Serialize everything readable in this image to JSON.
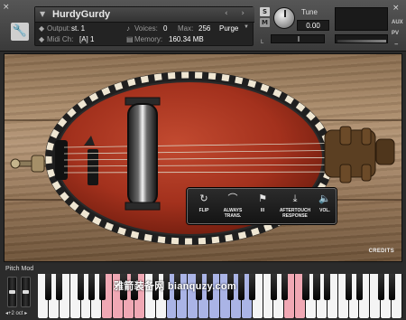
{
  "header": {
    "close_glyph": "×",
    "instrument": {
      "name": "HurdyGurdy",
      "nav": "‹ ›",
      "output_label": "Output:",
      "output_value": "st. 1",
      "voices_label": "Voices:",
      "voices_value": "0",
      "max_label": "Max:",
      "max_value": "256",
      "purge_label": "Purge",
      "midi_label": "Midi Ch:",
      "midi_value": "[A] 1",
      "memory_label": "Memory:",
      "memory_value": "160.34 MB"
    },
    "solo_label": "S",
    "mute_label": "M",
    "tune_label": "Tune",
    "tune_value": "0.00",
    "pan_left": "L",
    "aux_label": "AUX",
    "pv_label": "PV",
    "minus_glyph": "–",
    "icons": {
      "wrench": "wrench-icon",
      "tune_knob": "knob-icon"
    }
  },
  "stage": {
    "credits": "CREDITS",
    "controls": [
      {
        "icon": "refresh-icon",
        "glyph": "↻",
        "label": "FLIP"
      },
      {
        "icon": "curve-icon",
        "glyph": "⌒",
        "label": "ALWAYS\nTRANS."
      },
      {
        "icon": "flag-icon",
        "glyph": "⚑",
        "label": "III"
      },
      {
        "icon": "download-icon",
        "glyph": "⤓",
        "label": "AFTERTOUCH\nRESPONSE"
      },
      {
        "icon": "speaker-icon",
        "glyph": "🔈",
        "label": "VOL."
      }
    ]
  },
  "keyboard": {
    "pitch_label": "Pitch Mod",
    "octave_label": "◂+2 oct ▸",
    "watermark": "雅箭装备网 bianquzy.com",
    "white_key_count": 34,
    "highlighted_ranges": [
      [
        6,
        9
      ],
      [
        12,
        19
      ],
      [
        23,
        24
      ]
    ],
    "highlight_color": "#f0a8b4",
    "highlight_color_2": "#aab4e6"
  },
  "colors": {
    "body_red": "#a8311e",
    "wood": "#a98a69",
    "panel": "#232323"
  }
}
